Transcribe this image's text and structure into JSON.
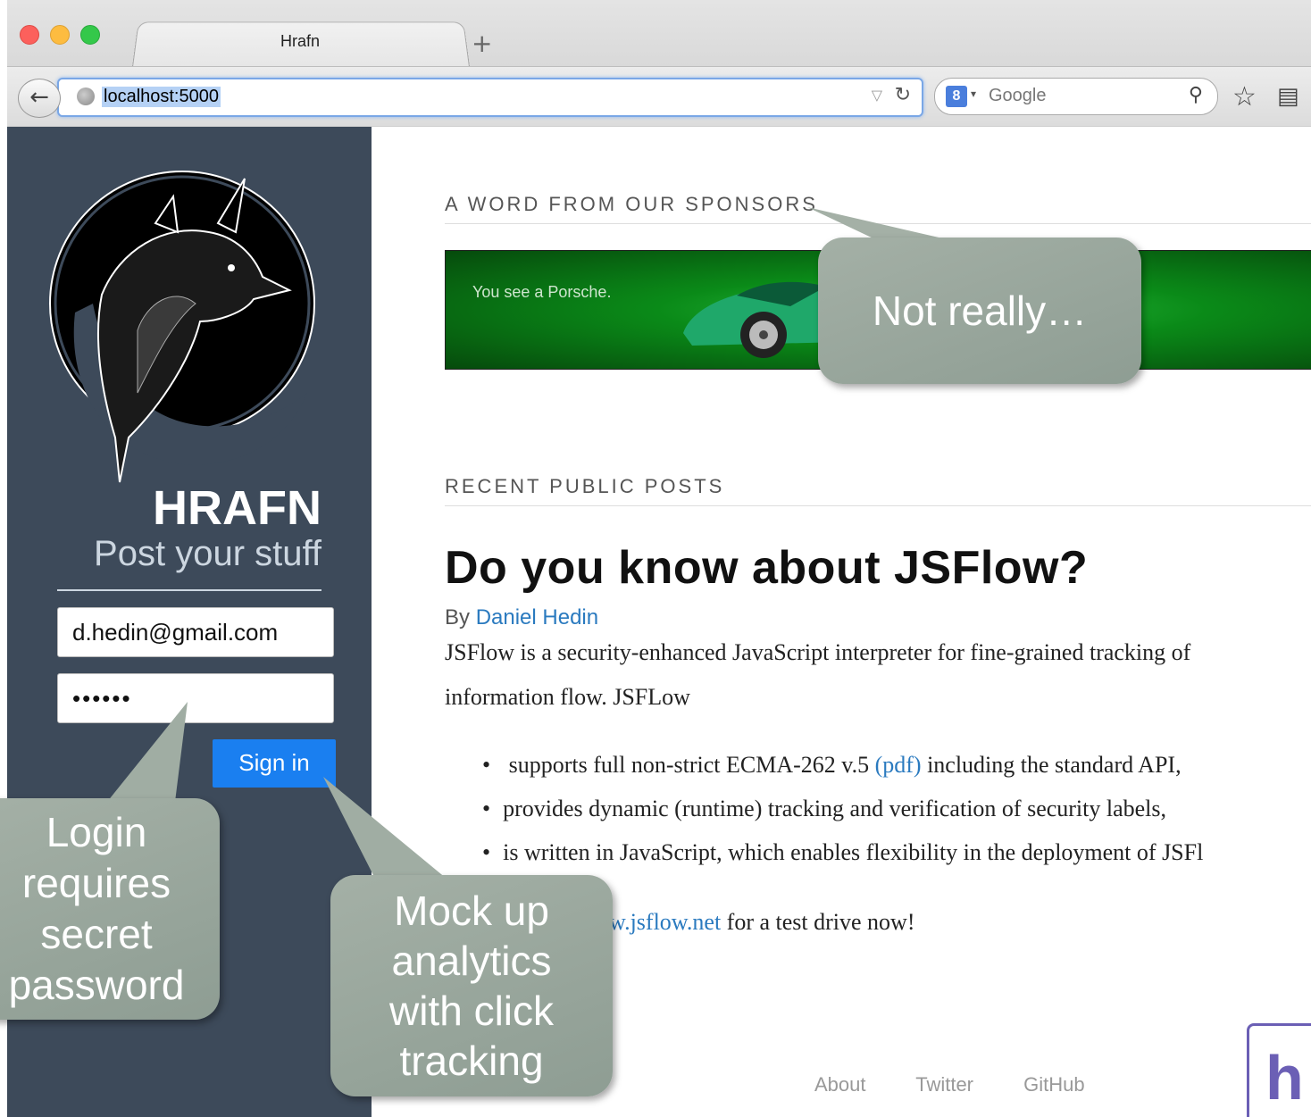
{
  "browser": {
    "tab_title": "Hrafn",
    "new_tab": "+",
    "url": "localhost:5000",
    "search_engine": "Google",
    "search_engine_icon": "8"
  },
  "sidebar": {
    "brand": "HRAFN",
    "tagline": "Post your stuff",
    "email_value": "d.hedin@gmail.com",
    "password_value": "••••••",
    "signin_label": "Sign in"
  },
  "main": {
    "sponsors_heading": "A WORD FROM OUR SPONSORS",
    "ad_text": "You see a Porsche.",
    "recent_heading": "RECENT PUBLIC POSTS",
    "post": {
      "title": "Do you know about JSFlow?",
      "by": "By",
      "author": "Daniel Hedin",
      "para1": "JSFlow is a security-enhanced JavaScript interpreter for fine-grained tracking of",
      "para2": "information flow. JSFLow",
      "bullet1_a": "supports full non-strict ECMA-262 v.5",
      "bullet1_link": "(pdf)",
      "bullet1_b": "including the standard API,",
      "bullet2": "provides dynamic (runtime) tracking and verification of security labels,",
      "bullet3": "is written in JavaScript, which enables flexibility in the deployment of JSFl",
      "cta_link": "w.jsflow.net",
      "cta_rest": "for a test drive now!"
    },
    "footer": {
      "about": "About",
      "twitter": "Twitter",
      "github": "GitHub"
    }
  },
  "callouts": {
    "sponsor": "Not really…",
    "login": [
      "Login",
      "requires",
      "secret",
      "password"
    ],
    "tracking": [
      "Mock up",
      "analytics",
      "with click",
      "tracking"
    ]
  },
  "colors": {
    "sidebar_bg": "#3d4a5a",
    "signin_bg": "#1a7ff0",
    "link": "#2a7abf",
    "callout_bg": "#9aa89e"
  }
}
